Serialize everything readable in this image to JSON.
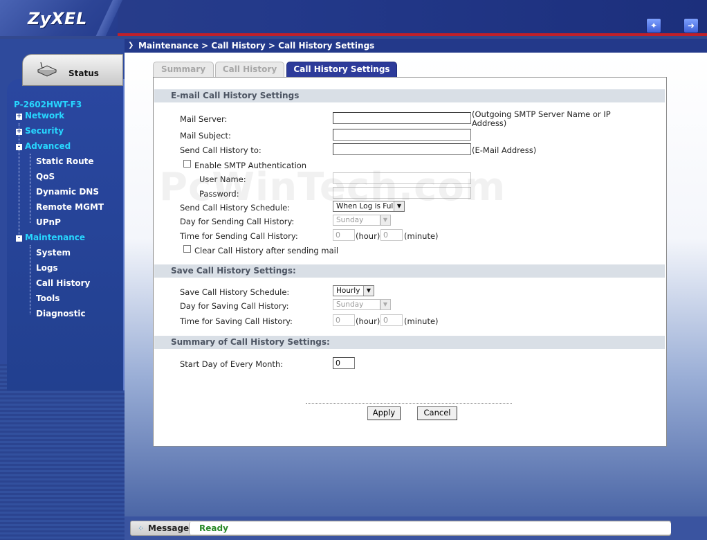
{
  "header": {
    "logo": "ZyXEL",
    "icons": [
      "wizard-icon",
      "logout-icon"
    ]
  },
  "sidebar": {
    "status_label": "Status",
    "model": "P-2602HWT-F3",
    "items": [
      {
        "label": "Network",
        "sign": "+"
      },
      {
        "label": "Security",
        "sign": "+"
      },
      {
        "label": "Advanced",
        "sign": "-"
      },
      {
        "label": "Maintenance",
        "sign": "-"
      }
    ],
    "advanced_children": [
      "Static Route",
      "QoS",
      "Dynamic DNS",
      "Remote MGMT",
      "UPnP"
    ],
    "maintenance_children": [
      "System",
      "Logs",
      "Call History",
      "Tools",
      "Diagnostic"
    ]
  },
  "breadcrumb": "Maintenance > Call History > Call History Settings",
  "tabs": [
    "Summary",
    "Call History",
    "Call History Settings"
  ],
  "email_section": {
    "title": "E-mail Call History Settings",
    "mail_server_label": "Mail Server:",
    "mail_server_value": "",
    "mail_server_note": "(Outgoing SMTP Server Name or IP Address)",
    "mail_subject_label": "Mail Subject:",
    "mail_subject_value": "",
    "send_to_label": "Send Call History to:",
    "send_to_value": "",
    "send_to_note": "(E-Mail Address)",
    "smtp_auth_label": "Enable SMTP Authentication",
    "smtp_auth_checked": false,
    "username_label": "User Name:",
    "username_value": "",
    "password_label": "Password:",
    "password_value": "",
    "schedule_label": "Send Call History Schedule:",
    "schedule_value": "When Log is Full",
    "day_label": "Day for Sending Call History:",
    "day_value": "Sunday",
    "time_label": "Time for Sending Call History:",
    "time_hour": "0",
    "time_minute": "0",
    "hour_unit": "(hour)",
    "minute_unit": "(minute)",
    "clear_label": "Clear Call History after sending mail",
    "clear_checked": false
  },
  "save_section": {
    "title": "Save Call History Settings:",
    "schedule_label": "Save Call History Schedule:",
    "schedule_value": "Hourly",
    "day_label": "Day for Saving Call History:",
    "day_value": "Sunday",
    "time_label": "Time for Saving Call History:",
    "time_hour": "0",
    "time_minute": "0",
    "hour_unit": "(hour)",
    "minute_unit": "(minute)"
  },
  "summary_section": {
    "title": "Summary of Call History Settings:",
    "start_day_label": "Start Day of Every Month:",
    "start_day_value": "0"
  },
  "buttons": {
    "apply": "Apply",
    "cancel": "Cancel"
  },
  "watermark": "PcWinTech.com",
  "statusbar": {
    "label": "Message",
    "text": "Ready"
  }
}
